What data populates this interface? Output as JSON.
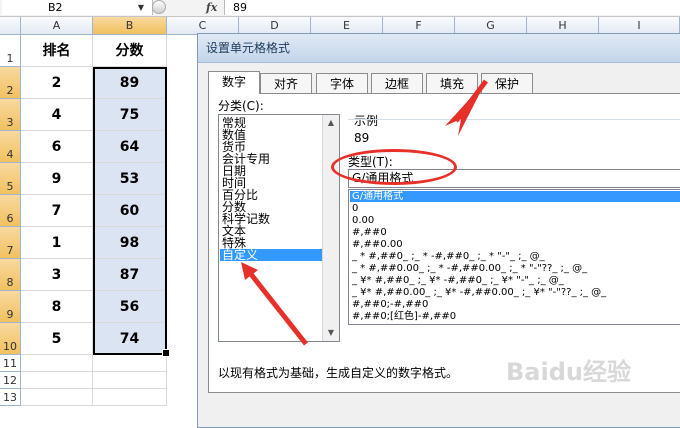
{
  "formula_bar": {
    "name_box": "B2",
    "name_box_dropdown": "▼",
    "fx_label": "fx",
    "value": "89"
  },
  "columns": [
    "A",
    "B",
    "C",
    "D",
    "E",
    "F",
    "G",
    "H",
    "I"
  ],
  "rows": [
    "1",
    "2",
    "3",
    "4",
    "5",
    "6",
    "7",
    "8",
    "9",
    "10",
    "11",
    "12",
    "13"
  ],
  "sheet": {
    "header_rank": "排名",
    "header_score": "分数",
    "ranks": [
      "2",
      "4",
      "6",
      "9",
      "7",
      "1",
      "3",
      "8",
      "5"
    ],
    "scores": [
      "89",
      "75",
      "64",
      "53",
      "60",
      "98",
      "87",
      "56",
      "74"
    ]
  },
  "dialog": {
    "title": "设置单元格格式",
    "tabs": [
      "数字",
      "对齐",
      "字体",
      "边框",
      "填充",
      "保护"
    ],
    "active_tab": 0,
    "category_label": "分类(C):",
    "categories": [
      "常规",
      "数值",
      "货币",
      "会计专用",
      "日期",
      "时间",
      "百分比",
      "分数",
      "科学记数",
      "文本",
      "特殊",
      "自定义"
    ],
    "selected_category": 11,
    "sample_label": "示例",
    "sample_value": "89",
    "type_label": "类型(T):",
    "type_value": "G/通用格式",
    "formats": [
      "G/通用格式",
      "0",
      "0.00",
      "#,##0",
      "#,##0.00",
      "_ * #,##0_ ;_ * -#,##0_ ;_ * \"-\"_ ;_ @_",
      "_ * #,##0.00_ ;_ * -#,##0.00_ ;_ * \"-\"??_ ;_ @_",
      "_ ¥* #,##0_ ;_ ¥* -#,##0_ ;_ ¥* \"-\"_ ;_ @_",
      "_ ¥* #,##0.00_ ;_ ¥* -#,##0.00_ ;_ ¥* \"-\"??_ ;_ @_",
      "#,##0;-#,##0",
      "#,##0;[红色]-#,##0"
    ],
    "selected_format": 0,
    "description": "以现有格式为基础，生成自定义的数字格式。"
  },
  "watermark": "Baidu经验",
  "colors": {
    "selection_fill": "#dbe4f2",
    "active_header": "#f1c15f",
    "annotation_red": "#e8302a",
    "list_highlight": "#3399ff"
  }
}
